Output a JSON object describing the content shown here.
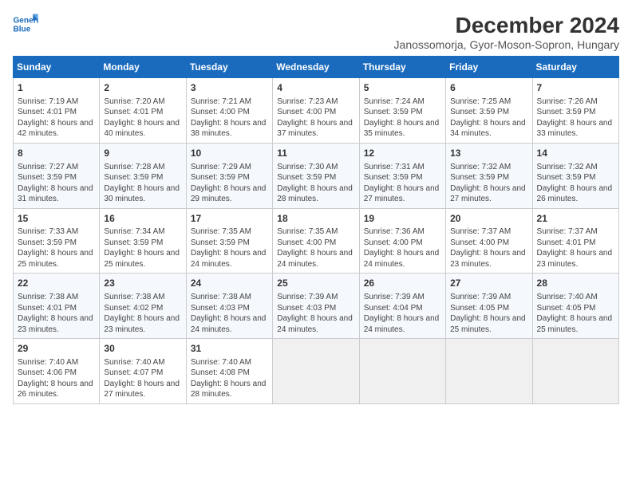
{
  "header": {
    "logo_line1": "General",
    "logo_line2": "Blue",
    "month_title": "December 2024",
    "subtitle": "Janossomorja, Gyor-Moson-Sopron, Hungary"
  },
  "weekdays": [
    "Sunday",
    "Monday",
    "Tuesday",
    "Wednesday",
    "Thursday",
    "Friday",
    "Saturday"
  ],
  "weeks": [
    [
      {
        "day": "1",
        "info": "Sunrise: 7:19 AM\nSunset: 4:01 PM\nDaylight: 8 hours and 42 minutes."
      },
      {
        "day": "2",
        "info": "Sunrise: 7:20 AM\nSunset: 4:01 PM\nDaylight: 8 hours and 40 minutes."
      },
      {
        "day": "3",
        "info": "Sunrise: 7:21 AM\nSunset: 4:00 PM\nDaylight: 8 hours and 38 minutes."
      },
      {
        "day": "4",
        "info": "Sunrise: 7:23 AM\nSunset: 4:00 PM\nDaylight: 8 hours and 37 minutes."
      },
      {
        "day": "5",
        "info": "Sunrise: 7:24 AM\nSunset: 3:59 PM\nDaylight: 8 hours and 35 minutes."
      },
      {
        "day": "6",
        "info": "Sunrise: 7:25 AM\nSunset: 3:59 PM\nDaylight: 8 hours and 34 minutes."
      },
      {
        "day": "7",
        "info": "Sunrise: 7:26 AM\nSunset: 3:59 PM\nDaylight: 8 hours and 33 minutes."
      }
    ],
    [
      {
        "day": "8",
        "info": "Sunrise: 7:27 AM\nSunset: 3:59 PM\nDaylight: 8 hours and 31 minutes."
      },
      {
        "day": "9",
        "info": "Sunrise: 7:28 AM\nSunset: 3:59 PM\nDaylight: 8 hours and 30 minutes."
      },
      {
        "day": "10",
        "info": "Sunrise: 7:29 AM\nSunset: 3:59 PM\nDaylight: 8 hours and 29 minutes."
      },
      {
        "day": "11",
        "info": "Sunrise: 7:30 AM\nSunset: 3:59 PM\nDaylight: 8 hours and 28 minutes."
      },
      {
        "day": "12",
        "info": "Sunrise: 7:31 AM\nSunset: 3:59 PM\nDaylight: 8 hours and 27 minutes."
      },
      {
        "day": "13",
        "info": "Sunrise: 7:32 AM\nSunset: 3:59 PM\nDaylight: 8 hours and 27 minutes."
      },
      {
        "day": "14",
        "info": "Sunrise: 7:32 AM\nSunset: 3:59 PM\nDaylight: 8 hours and 26 minutes."
      }
    ],
    [
      {
        "day": "15",
        "info": "Sunrise: 7:33 AM\nSunset: 3:59 PM\nDaylight: 8 hours and 25 minutes."
      },
      {
        "day": "16",
        "info": "Sunrise: 7:34 AM\nSunset: 3:59 PM\nDaylight: 8 hours and 25 minutes."
      },
      {
        "day": "17",
        "info": "Sunrise: 7:35 AM\nSunset: 3:59 PM\nDaylight: 8 hours and 24 minutes."
      },
      {
        "day": "18",
        "info": "Sunrise: 7:35 AM\nSunset: 4:00 PM\nDaylight: 8 hours and 24 minutes."
      },
      {
        "day": "19",
        "info": "Sunrise: 7:36 AM\nSunset: 4:00 PM\nDaylight: 8 hours and 24 minutes."
      },
      {
        "day": "20",
        "info": "Sunrise: 7:37 AM\nSunset: 4:00 PM\nDaylight: 8 hours and 23 minutes."
      },
      {
        "day": "21",
        "info": "Sunrise: 7:37 AM\nSunset: 4:01 PM\nDaylight: 8 hours and 23 minutes."
      }
    ],
    [
      {
        "day": "22",
        "info": "Sunrise: 7:38 AM\nSunset: 4:01 PM\nDaylight: 8 hours and 23 minutes."
      },
      {
        "day": "23",
        "info": "Sunrise: 7:38 AM\nSunset: 4:02 PM\nDaylight: 8 hours and 23 minutes."
      },
      {
        "day": "24",
        "info": "Sunrise: 7:38 AM\nSunset: 4:03 PM\nDaylight: 8 hours and 24 minutes."
      },
      {
        "day": "25",
        "info": "Sunrise: 7:39 AM\nSunset: 4:03 PM\nDaylight: 8 hours and 24 minutes."
      },
      {
        "day": "26",
        "info": "Sunrise: 7:39 AM\nSunset: 4:04 PM\nDaylight: 8 hours and 24 minutes."
      },
      {
        "day": "27",
        "info": "Sunrise: 7:39 AM\nSunset: 4:05 PM\nDaylight: 8 hours and 25 minutes."
      },
      {
        "day": "28",
        "info": "Sunrise: 7:40 AM\nSunset: 4:05 PM\nDaylight: 8 hours and 25 minutes."
      }
    ],
    [
      {
        "day": "29",
        "info": "Sunrise: 7:40 AM\nSunset: 4:06 PM\nDaylight: 8 hours and 26 minutes."
      },
      {
        "day": "30",
        "info": "Sunrise: 7:40 AM\nSunset: 4:07 PM\nDaylight: 8 hours and 27 minutes."
      },
      {
        "day": "31",
        "info": "Sunrise: 7:40 AM\nSunset: 4:08 PM\nDaylight: 8 hours and 28 minutes."
      },
      null,
      null,
      null,
      null
    ]
  ]
}
